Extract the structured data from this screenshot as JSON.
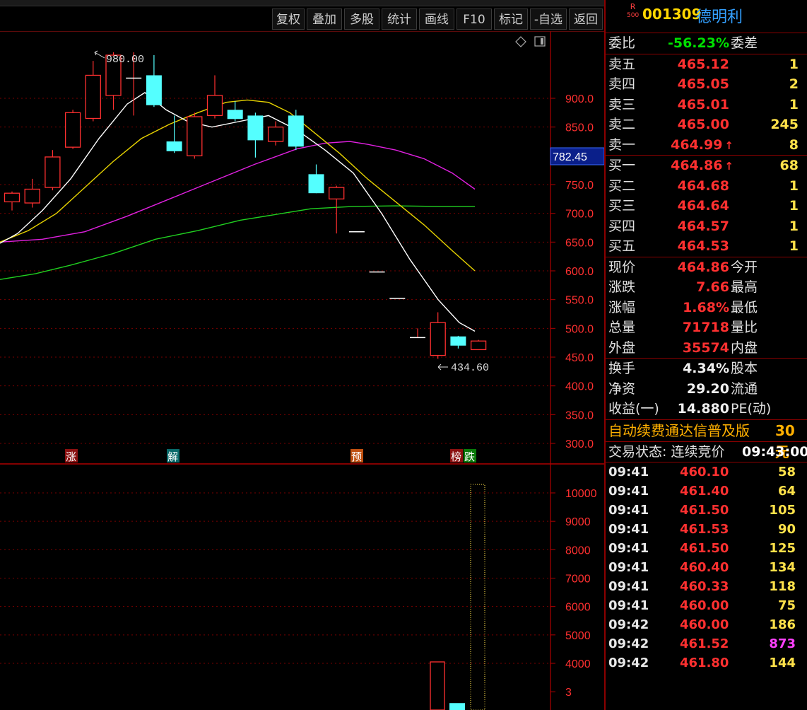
{
  "toolbar": {
    "buttons": [
      "复权",
      "叠加",
      "多股",
      "统计",
      "画线",
      "F10",
      "标记",
      "-自选",
      "返回"
    ]
  },
  "chart_data": {
    "type": "candlestick",
    "price_axis": {
      "ticks": [
        900.0,
        850.0,
        750.0,
        700.0,
        650.0,
        600.0,
        550.0,
        500.0,
        450.0,
        400.0,
        350.0,
        300.0
      ],
      "tick_labels": [
        "900.0",
        "850.0",
        "750.0",
        "700.0",
        "650.0",
        "600.0",
        "550.0",
        "500.0",
        "450.0",
        "400.0",
        "350.0",
        "300.0"
      ],
      "range": [
        280,
        1000
      ]
    },
    "current_marker": "782.45",
    "high_label": "980.00",
    "low_label": "434.60",
    "candles": [
      {
        "o": 720,
        "c": 735,
        "h": 738,
        "l": 705
      },
      {
        "o": 718,
        "c": 742,
        "h": 760,
        "l": 710
      },
      {
        "o": 745,
        "c": 798,
        "h": 810,
        "l": 740
      },
      {
        "o": 815,
        "c": 875,
        "h": 880,
        "l": 812
      },
      {
        "o": 865,
        "c": 940,
        "h": 965,
        "l": 860
      },
      {
        "o": 905,
        "c": 975,
        "h": 980,
        "l": 880
      },
      {
        "o": 935,
        "c": 935,
        "h": 980,
        "l": 870
      },
      {
        "o": 940,
        "c": 888,
        "h": 975,
        "l": 885
      },
      {
        "o": 825,
        "c": 808,
        "h": 870,
        "l": 805
      },
      {
        "o": 800,
        "c": 868,
        "h": 875,
        "l": 795
      },
      {
        "o": 870,
        "c": 905,
        "h": 940,
        "l": 865
      },
      {
        "o": 880,
        "c": 864,
        "h": 895,
        "l": 860
      },
      {
        "o": 870,
        "c": 827,
        "h": 875,
        "l": 797
      },
      {
        "o": 825,
        "c": 850,
        "h": 860,
        "l": 818
      },
      {
        "o": 870,
        "c": 816,
        "h": 880,
        "l": 810
      },
      {
        "o": 768,
        "c": 735,
        "h": 785,
        "l": 735
      },
      {
        "o": 725,
        "c": 745,
        "h": 748,
        "l": 665
      },
      {
        "o": 668,
        "c": 668,
        "h": 668,
        "l": 668
      },
      {
        "o": 598,
        "c": 598,
        "h": 598,
        "l": 598
      },
      {
        "o": 552,
        "c": 552,
        "h": 552,
        "l": 552
      },
      {
        "o": 484,
        "c": 484,
        "h": 500,
        "l": 484
      },
      {
        "o": 453,
        "c": 510,
        "h": 528,
        "l": 447
      },
      {
        "o": 486,
        "c": 470,
        "h": 487,
        "l": 465
      },
      {
        "o": 463,
        "c": 478,
        "h": 480,
        "l": 463
      }
    ],
    "ma5": [
      [
        0,
        648
      ],
      [
        25,
        665
      ],
      [
        60,
        705
      ],
      [
        100,
        760
      ],
      [
        140,
        830
      ],
      [
        180,
        890
      ],
      [
        205,
        910
      ],
      [
        235,
        880
      ],
      [
        265,
        860
      ],
      [
        300,
        850
      ],
      [
        340,
        860
      ],
      [
        380,
        870
      ],
      [
        420,
        845
      ],
      [
        460,
        810
      ],
      [
        500,
        770
      ],
      [
        540,
        700
      ],
      [
        580,
        620
      ],
      [
        620,
        550
      ],
      [
        650,
        510
      ],
      [
        672,
        495
      ]
    ],
    "ma10": [
      [
        0,
        650
      ],
      [
        40,
        670
      ],
      [
        80,
        700
      ],
      [
        120,
        745
      ],
      [
        160,
        790
      ],
      [
        200,
        830
      ],
      [
        240,
        855
      ],
      [
        280,
        875
      ],
      [
        320,
        893
      ],
      [
        350,
        897
      ],
      [
        380,
        893
      ],
      [
        410,
        875
      ],
      [
        440,
        845
      ],
      [
        480,
        805
      ],
      [
        520,
        760
      ],
      [
        560,
        720
      ],
      [
        600,
        680
      ],
      [
        640,
        635
      ],
      [
        672,
        600
      ]
    ],
    "ma20": [
      [
        0,
        650
      ],
      [
        60,
        655
      ],
      [
        120,
        668
      ],
      [
        180,
        695
      ],
      [
        240,
        725
      ],
      [
        300,
        755
      ],
      [
        360,
        785
      ],
      [
        420,
        812
      ],
      [
        460,
        822
      ],
      [
        495,
        825
      ],
      [
        520,
        820
      ],
      [
        560,
        810
      ],
      [
        600,
        795
      ],
      [
        640,
        770
      ],
      [
        672,
        742
      ]
    ],
    "ma60": [
      [
        0,
        585
      ],
      [
        50,
        595
      ],
      [
        100,
        610
      ],
      [
        160,
        630
      ],
      [
        220,
        655
      ],
      [
        280,
        670
      ],
      [
        340,
        688
      ],
      [
        400,
        700
      ],
      [
        440,
        708
      ],
      [
        500,
        712
      ],
      [
        560,
        713
      ],
      [
        620,
        712
      ],
      [
        672,
        712
      ]
    ],
    "signals": [
      "涨",
      "解",
      "预",
      "榜",
      "跌"
    ],
    "volume_axis": {
      "ticks": [
        10000,
        9000,
        8000,
        7000,
        6000,
        5000,
        4000
      ],
      "tick_labels": [
        "10000",
        "9000",
        "8000",
        "7000",
        "6000",
        "5000",
        "4000",
        "3"
      ]
    },
    "volume_bars": [
      {
        "v": 4050,
        "color": "red"
      },
      {
        "v": 2600,
        "color": "cyan"
      },
      {
        "v": 10300,
        "color": "yellow-dotted"
      }
    ]
  },
  "quote": {
    "r_badge": "R",
    "r_sub": "500",
    "code": "001309",
    "name": "德明利",
    "weibi_label": "委比",
    "weibi": "-56.23%",
    "weicha_label": "委差",
    "sells": [
      {
        "label": "卖五",
        "price": "465.12",
        "vol": "1"
      },
      {
        "label": "卖四",
        "price": "465.05",
        "vol": "2"
      },
      {
        "label": "卖三",
        "price": "465.01",
        "vol": "1"
      },
      {
        "label": "卖二",
        "price": "465.00",
        "vol": "245"
      },
      {
        "label": "卖一",
        "price": "464.99",
        "vol": "8"
      }
    ],
    "buys": [
      {
        "label": "买一",
        "price": "464.86",
        "vol": "68"
      },
      {
        "label": "买二",
        "price": "464.68",
        "vol": "1"
      },
      {
        "label": "买三",
        "price": "464.64",
        "vol": "1"
      },
      {
        "label": "买四",
        "price": "464.57",
        "vol": "1"
      },
      {
        "label": "买五",
        "price": "464.53",
        "vol": "1"
      }
    ],
    "stats": [
      {
        "label": "现价",
        "value": "464.86",
        "label2": "今开"
      },
      {
        "label": "涨跌",
        "value": "7.66",
        "label2": "最高"
      },
      {
        "label": "涨幅",
        "value": "1.68%",
        "label2": "最低"
      },
      {
        "label": "总量",
        "value": "71718",
        "label2": "量比"
      },
      {
        "label": "外盘",
        "value": "35574",
        "label2": "内盘"
      }
    ],
    "fundamentals": [
      {
        "label": "换手",
        "value": "4.34%",
        "label2": "股本"
      },
      {
        "label": "净资",
        "value": "29.20",
        "label2": "流通"
      },
      {
        "label": "收益(一)",
        "value": "14.880",
        "label2": "PE(动)"
      }
    ],
    "ad_text": "自动续费通达信普及版",
    "ad_price": "30元",
    "state_label": "交易状态: 连续竞价",
    "state_time": "09:43:00"
  },
  "ticks": [
    {
      "time": "09:41",
      "price": "460.10",
      "vol": "58"
    },
    {
      "time": "09:41",
      "price": "461.40",
      "vol": "64"
    },
    {
      "time": "09:41",
      "price": "461.50",
      "vol": "105"
    },
    {
      "time": "09:41",
      "price": "461.53",
      "vol": "90"
    },
    {
      "time": "09:41",
      "price": "461.50",
      "vol": "125"
    },
    {
      "time": "09:41",
      "price": "460.40",
      "vol": "134"
    },
    {
      "time": "09:41",
      "price": "460.33",
      "vol": "118"
    },
    {
      "time": "09:41",
      "price": "460.00",
      "vol": "75"
    },
    {
      "time": "09:42",
      "price": "460.00",
      "vol": "186"
    },
    {
      "time": "09:42",
      "price": "461.52",
      "vol": "873"
    },
    {
      "time": "09:42",
      "price": "461.80",
      "vol": "144"
    }
  ],
  "colors": {
    "up": "#ff3030",
    "down": "#54ffff",
    "grid": "#8b0000",
    "ma5": "#ffffff",
    "ma10": "#e6d200",
    "ma20": "#e020e0",
    "ma60": "#20d020"
  }
}
